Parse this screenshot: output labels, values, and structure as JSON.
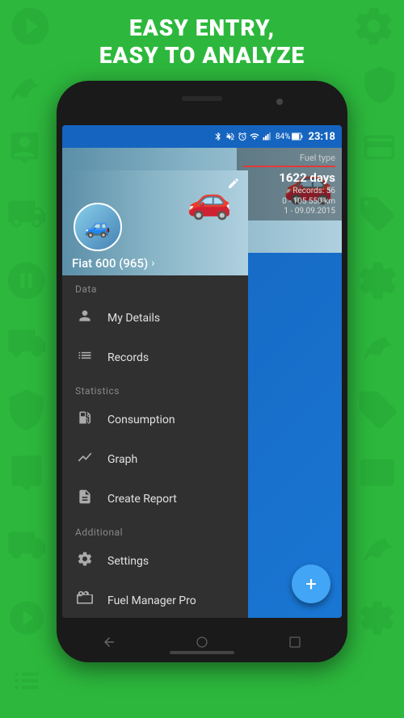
{
  "header": {
    "line1": "EASY ENTRY,",
    "line2": "EASY TO ANALYZE"
  },
  "statusBar": {
    "time": "23:18",
    "battery": "84%",
    "signal": "●●●●",
    "icons": [
      "bluetooth",
      "phone-mute",
      "alarm",
      "wifi",
      "signal",
      "battery"
    ]
  },
  "car": {
    "name": "Fiat 600 (965)",
    "days": "1622 days",
    "records_label": "Records:",
    "records_count": "56",
    "km_range": "0 - 105 550 km",
    "date_range": "1 - 09.09.2015",
    "fuel_type": "Fuel type"
  },
  "sections": {
    "data": {
      "label": "Data",
      "items": [
        {
          "id": "my-details",
          "label": "My Details",
          "icon": "person"
        },
        {
          "id": "records",
          "label": "Records",
          "icon": "list"
        }
      ]
    },
    "statistics": {
      "label": "Statistics",
      "items": [
        {
          "id": "consumption",
          "label": "Consumption",
          "icon": "fuel"
        },
        {
          "id": "graph",
          "label": "Graph",
          "icon": "graph"
        },
        {
          "id": "create-report",
          "label": "Create Report",
          "icon": "report"
        }
      ]
    },
    "additional": {
      "label": "Additional",
      "items": [
        {
          "id": "settings",
          "label": "Settings",
          "icon": "gear"
        },
        {
          "id": "fuel-manager-pro",
          "label": "Fuel Manager Pro",
          "icon": "bag"
        }
      ]
    }
  },
  "fab": {
    "label": "+"
  }
}
